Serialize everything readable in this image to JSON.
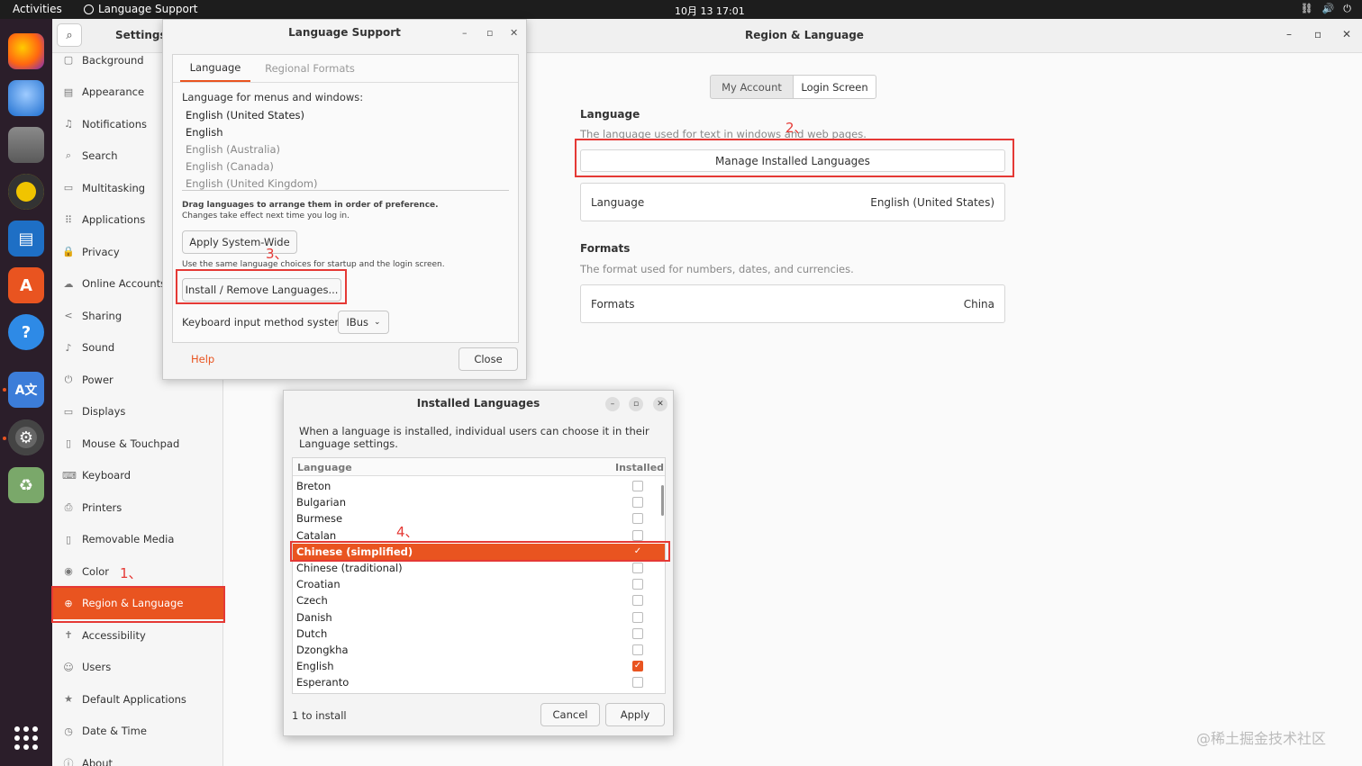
{
  "topbar": {
    "activities": "Activities",
    "app_name": "Language Support",
    "clock": "10月 13  17:01",
    "tray": [
      "⛓",
      "🔊",
      "⏻"
    ]
  },
  "dock": {
    "items": [
      "firefox-icon",
      "thunderbird-icon",
      "files-icon",
      "rhythmbox-icon",
      "writer-icon",
      "software-icon",
      "help-icon",
      "language-icon",
      "settings-icon",
      "trash-icon",
      "apps-grid-icon"
    ]
  },
  "settings": {
    "title": "Settings",
    "items": [
      {
        "label": "Background",
        "icon": "▢"
      },
      {
        "label": "Appearance",
        "icon": "▤"
      },
      {
        "label": "Notifications",
        "icon": "♫"
      },
      {
        "label": "Search",
        "icon": "⌕"
      },
      {
        "label": "Multitasking",
        "icon": "▭"
      },
      {
        "label": "Applications",
        "icon": "⠿"
      },
      {
        "label": "Privacy",
        "icon": "🔒"
      },
      {
        "label": "Online Accounts",
        "icon": "☁"
      },
      {
        "label": "Sharing",
        "icon": "<"
      },
      {
        "label": "Sound",
        "icon": "♪"
      },
      {
        "label": "Power",
        "icon": "⏻"
      },
      {
        "label": "Displays",
        "icon": "▭"
      },
      {
        "label": "Mouse & Touchpad",
        "icon": "▯"
      },
      {
        "label": "Keyboard",
        "icon": "⌨"
      },
      {
        "label": "Printers",
        "icon": "⎙"
      },
      {
        "label": "Removable Media",
        "icon": "▯"
      },
      {
        "label": "Color",
        "icon": "◉"
      },
      {
        "label": "Region & Language",
        "icon": "⊕"
      },
      {
        "label": "Accessibility",
        "icon": "✝"
      },
      {
        "label": "Users",
        "icon": "☺"
      },
      {
        "label": "Default Applications",
        "icon": "★"
      },
      {
        "label": "Date & Time",
        "icon": "◷"
      },
      {
        "label": "About",
        "icon": "ⓘ"
      }
    ]
  },
  "region": {
    "title": "Region & Language",
    "tabs": [
      "My Account",
      "Login Screen"
    ],
    "language_heading": "Language",
    "language_sub": "The language used for text in windows and web pages.",
    "manage_button": "Manage Installed Languages",
    "language_label": "Language",
    "language_value": "English (United States)",
    "formats_heading": "Formats",
    "formats_sub": "The format used for numbers, dates, and currencies.",
    "formats_label": "Formats",
    "formats_value": "China"
  },
  "lang_support": {
    "title": "Language Support",
    "tabs": [
      "Language",
      "Regional Formats"
    ],
    "menus_label": "Language for menus and windows:",
    "languages": [
      "English (United States)",
      "English",
      "English (Australia)",
      "English (Canada)",
      "English (United Kingdom)"
    ],
    "drag_note_bold": "Drag languages to arrange them in order of preference.",
    "drag_note": "Changes take effect next time you log in.",
    "apply_button": "Apply System-Wide",
    "apply_note": "Use the same language choices for startup and the login screen.",
    "install_button": "Install / Remove Languages...",
    "keyboard_label": "Keyboard input method system:",
    "keyboard_value": "IBus",
    "help": "Help",
    "close": "Close"
  },
  "installed": {
    "title": "Installed Languages",
    "description": "When a language is installed, individual users can choose it in their Language settings.",
    "col_language": "Language",
    "col_installed": "Installed",
    "rows": [
      {
        "name": "Breton",
        "installed": false
      },
      {
        "name": "Bulgarian",
        "installed": false
      },
      {
        "name": "Burmese",
        "installed": false
      },
      {
        "name": "Catalan",
        "installed": false
      },
      {
        "name": "Chinese (simplified)",
        "installed": true
      },
      {
        "name": "Chinese (traditional)",
        "installed": false
      },
      {
        "name": "Croatian",
        "installed": false
      },
      {
        "name": "Czech",
        "installed": false
      },
      {
        "name": "Danish",
        "installed": false
      },
      {
        "name": "Dutch",
        "installed": false
      },
      {
        "name": "Dzongkha",
        "installed": false
      },
      {
        "name": "English",
        "installed": true
      },
      {
        "name": "Esperanto",
        "installed": false
      }
    ],
    "status": "1 to install",
    "cancel": "Cancel",
    "apply": "Apply"
  },
  "annotations": [
    "1、",
    "2、",
    "3、",
    "4、"
  ],
  "watermark": "@稀土掘金技术社区",
  "colors": {
    "accent": "#e95420",
    "annotation": "#e53935",
    "dock": "#2b1e2a",
    "topbar": "#1d1d1d"
  }
}
